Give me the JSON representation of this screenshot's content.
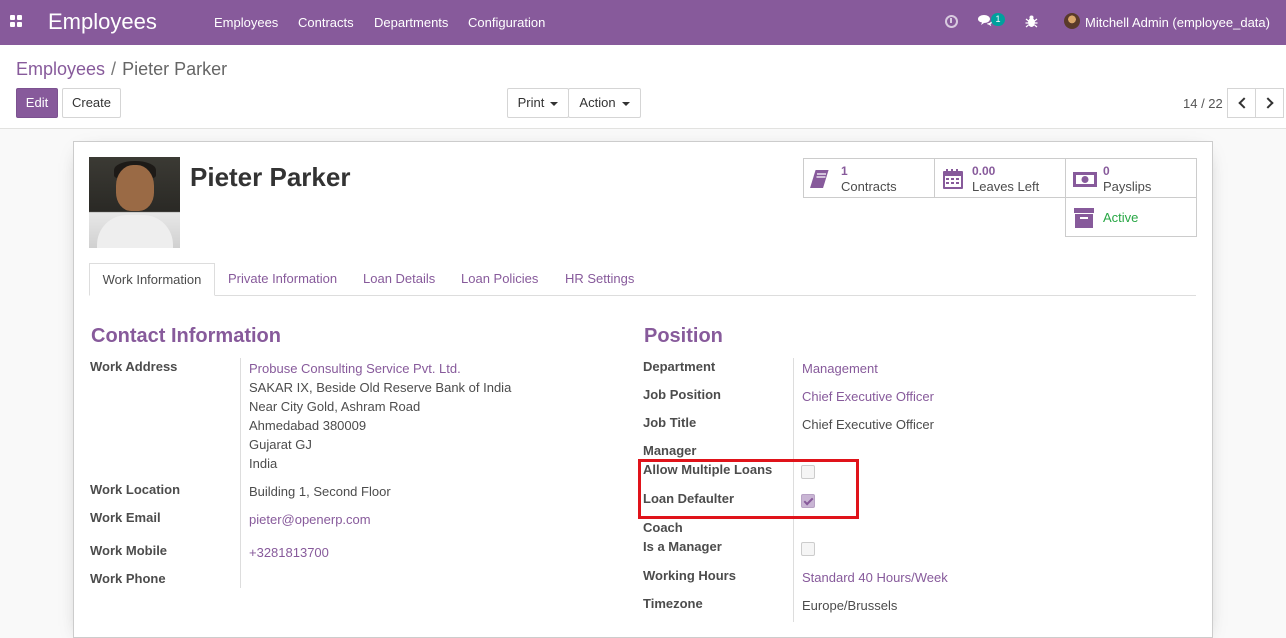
{
  "navbar": {
    "app_title": "Employees",
    "menu": [
      "Employees",
      "Contracts",
      "Departments",
      "Configuration"
    ],
    "messages_badge": "1",
    "user": "Mitchell Admin (employee_data)",
    "icons": [
      "apps-icon",
      "clock-icon",
      "chat-icon",
      "bug-icon"
    ]
  },
  "breadcrumb": {
    "parent": "Employees",
    "separator": "/",
    "current": "Pieter Parker"
  },
  "toolbar": {
    "edit": "Edit",
    "create": "Create",
    "print": "Print",
    "action": "Action"
  },
  "pager": {
    "value": "14 / 22"
  },
  "employee": {
    "name": "Pieter Parker",
    "stats": {
      "contracts": {
        "value": "1",
        "label": "Contracts"
      },
      "leaves": {
        "value": "0.00",
        "label": "Leaves Left"
      },
      "payslips": {
        "value": "0",
        "label": "Payslips"
      },
      "active": "Active"
    }
  },
  "tabs": [
    "Work Information",
    "Private Information",
    "Loan Details",
    "Loan Policies",
    "HR Settings"
  ],
  "contact": {
    "title": "Contact Information",
    "work_address_label": "Work Address",
    "work_address_company": "Probuse Consulting Service Pvt. Ltd.",
    "work_address_lines": [
      "SAKAR IX, Beside Old Reserve Bank of India",
      "Near City Gold, Ashram Road",
      "Ahmedabad 380009",
      "Gujarat GJ",
      "India"
    ],
    "work_location_label": "Work Location",
    "work_location": "Building 1, Second Floor",
    "work_email_label": "Work Email",
    "work_email": "pieter@openerp.com",
    "work_mobile_label": "Work Mobile",
    "work_mobile": "+3281813700",
    "work_phone_label": "Work Phone"
  },
  "position": {
    "title": "Position",
    "department_label": "Department",
    "department": "Management",
    "job_position_label": "Job Position",
    "job_position": "Chief Executive Officer",
    "job_title_label": "Job Title",
    "job_title": "Chief Executive Officer",
    "manager_label": "Manager",
    "allow_multiple_loans_label": "Allow Multiple Loans",
    "allow_multiple_loans": false,
    "loan_defaulter_label": "Loan Defaulter",
    "loan_defaulter": true,
    "coach_label": "Coach",
    "is_manager_label": "Is a Manager",
    "is_manager": false,
    "working_hours_label": "Working Hours",
    "working_hours": "Standard 40 Hours/Week",
    "timezone_label": "Timezone",
    "timezone": "Europe/Brussels"
  },
  "colors": {
    "brand": "#875a9b",
    "highlight": "#e0131a",
    "active": "#28a745"
  }
}
